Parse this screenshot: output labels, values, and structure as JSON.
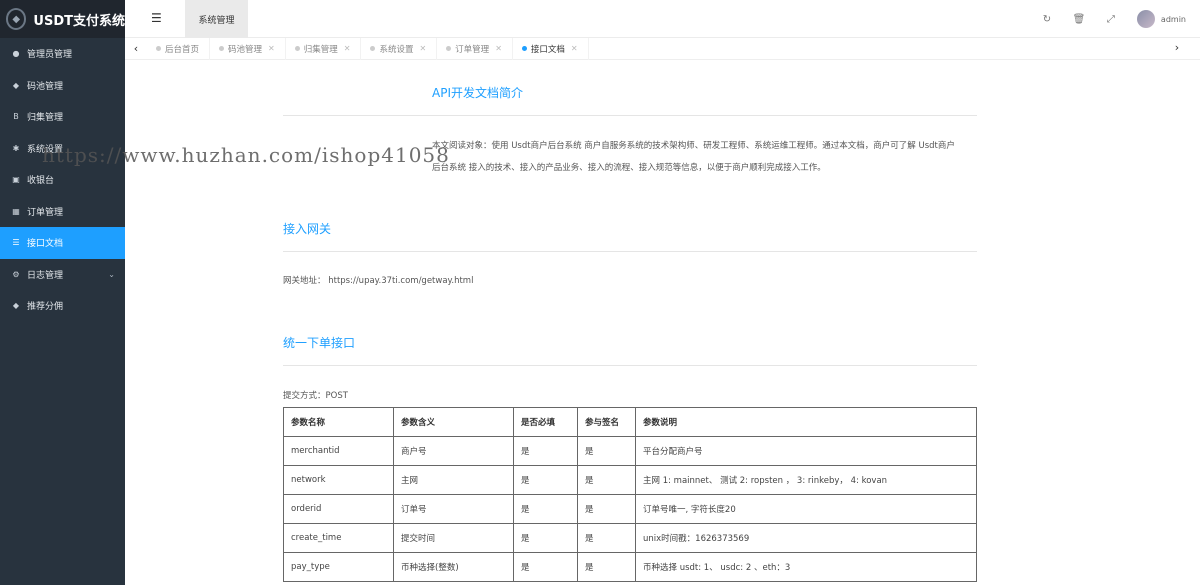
{
  "app": {
    "logo_text": "USDT支付系统"
  },
  "sidebar": {
    "items": [
      {
        "label": "管理员管理",
        "icon": "user-icon"
      },
      {
        "label": "码池管理",
        "icon": "diamond-icon"
      },
      {
        "label": "归集管理",
        "icon": "bitcoin-icon"
      },
      {
        "label": "系统设置",
        "icon": "gear-icon"
      },
      {
        "label": "收银台",
        "icon": "cashier-icon"
      },
      {
        "label": "订单管理",
        "icon": "calculator-icon"
      },
      {
        "label": "接口文档",
        "icon": "list-icon",
        "active": true
      },
      {
        "label": "日志管理",
        "icon": "log-icon",
        "has_children": true
      },
      {
        "label": "推荐分佣",
        "icon": "diamond-icon"
      }
    ]
  },
  "header": {
    "tab_label": "系统管理",
    "username": "admin"
  },
  "tabs": [
    {
      "label": "后台首页",
      "active": false
    },
    {
      "label": "码池管理",
      "active": false
    },
    {
      "label": "归集管理",
      "active": false
    },
    {
      "label": "系统设置",
      "active": false
    },
    {
      "label": "订单管理",
      "active": false
    },
    {
      "label": "接口文档",
      "active": true
    }
  ],
  "doc": {
    "intro_title": "API开发文档简介",
    "intro_line1": "本文阅读对象：使用 Usdt商户后台系统 商户自服务系统的技术架构师、研发工程师、系统运维工程师。通过本文档，商户可了解 Usdt商户",
    "intro_line2": "后台系统 接入的技术、接入的产品业务、接入的流程、接入规范等信息，以便于商户顺利完成接入工作。",
    "gateway_title": "接入网关",
    "gateway_label": "网关地址：",
    "gateway_url": "https://upay.37ti.com/getway.html",
    "order_title": "统一下单接口",
    "submit_method": "提交方式：POST",
    "table": {
      "headers": [
        "参数名称",
        "参数含义",
        "是否必填",
        "参与签名",
        "参数说明"
      ],
      "rows": [
        [
          "merchantid",
          "商户号",
          "是",
          "是",
          "平台分配商户号"
        ],
        [
          "network",
          "主网",
          "是",
          "是",
          "主网 1: mainnet、 测试 2: ropsten ， 3: rinkeby， 4: kovan"
        ],
        [
          "orderid",
          "订单号",
          "是",
          "是",
          "订单号唯一, 字符长度20"
        ],
        [
          "create_time",
          "提交时间",
          "是",
          "是",
          "unix时间戳：1626373569"
        ],
        [
          "pay_type",
          "币种选择(整数)",
          "是",
          "是",
          "币种选择 usdt: 1、 usdc: 2 、eth：3"
        ]
      ]
    }
  },
  "watermark": "https://www.huzhan.com/ishop41058"
}
